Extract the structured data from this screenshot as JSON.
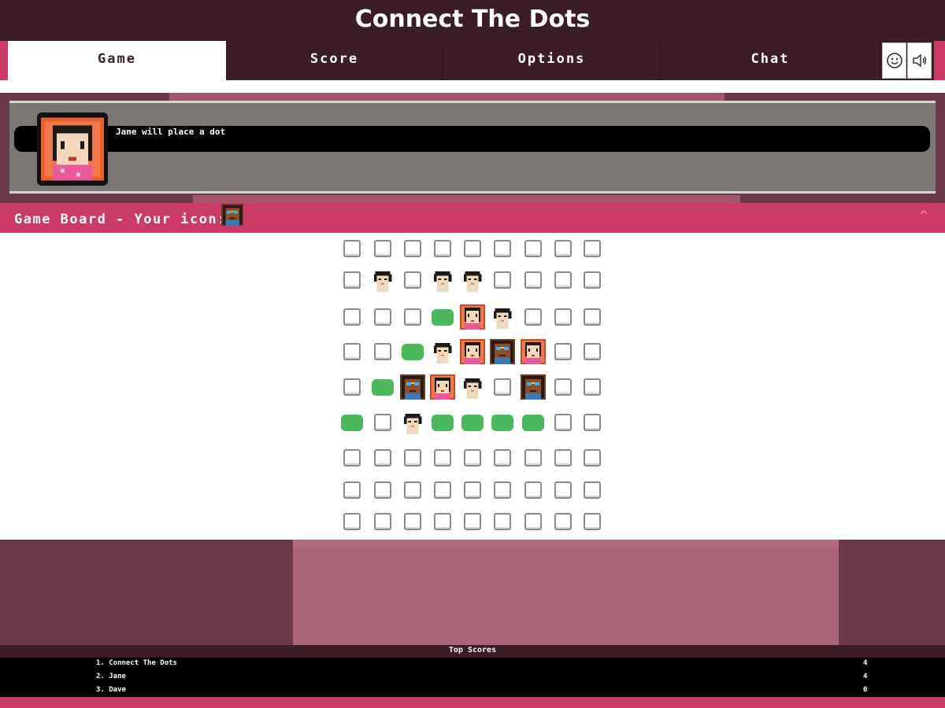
{
  "title": "Connect The Dots",
  "tabs": [
    {
      "label": "Game",
      "active": true
    },
    {
      "label": "Score",
      "active": false
    },
    {
      "label": "Options",
      "active": false
    },
    {
      "label": "Chat",
      "active": false
    }
  ],
  "toolbar": {
    "emoji_icon": "smiley-icon",
    "sound_icon": "speaker-icon"
  },
  "message": {
    "text": "Jane will place a dot",
    "portrait": "jane"
  },
  "board_header": {
    "label": "Game Board - Your icon:",
    "your_icon": "dave"
  },
  "board": {
    "legend": {
      "e": "empty",
      "g": "green-dot",
      "b": "bob",
      "j": "jane",
      "d": "dave"
    },
    "rows": [
      [
        "e",
        "e",
        "e",
        "e",
        "e",
        "e",
        "e",
        "e",
        "e"
      ],
      [
        "e",
        "b",
        "e",
        "b",
        "b",
        "e",
        "e",
        "e",
        "e"
      ],
      [
        "e",
        "e",
        "e",
        "g",
        "j",
        "b",
        "e",
        "e",
        "e"
      ],
      [
        "e",
        "e",
        "g",
        "b",
        "j",
        "d",
        "j",
        "e",
        "e"
      ],
      [
        "e",
        "g",
        "d",
        "j",
        "b",
        "e",
        "d",
        "e",
        "e"
      ],
      [
        "g",
        "e",
        "b",
        "g",
        "g",
        "g",
        "g",
        "e",
        "e"
      ],
      [
        "e",
        "e",
        "e",
        "e",
        "e",
        "e",
        "e",
        "e",
        "e"
      ],
      [
        "e",
        "e",
        "e",
        "e",
        "e",
        "e",
        "e",
        "e",
        "e"
      ],
      [
        "e",
        "e",
        "e",
        "e",
        "e",
        "e",
        "e",
        "e",
        "e"
      ]
    ]
  },
  "top_scores": {
    "title": "Top Scores",
    "entries": [
      {
        "name": "1. Connect The Dots",
        "score": "4"
      },
      {
        "name": "2. Jane",
        "score": "4"
      },
      {
        "name": "3. Dave",
        "score": "0"
      }
    ]
  },
  "colors": {
    "accent": "#cc3a67",
    "dark": "#3b1d25",
    "dot_green": "#4cb85c"
  }
}
